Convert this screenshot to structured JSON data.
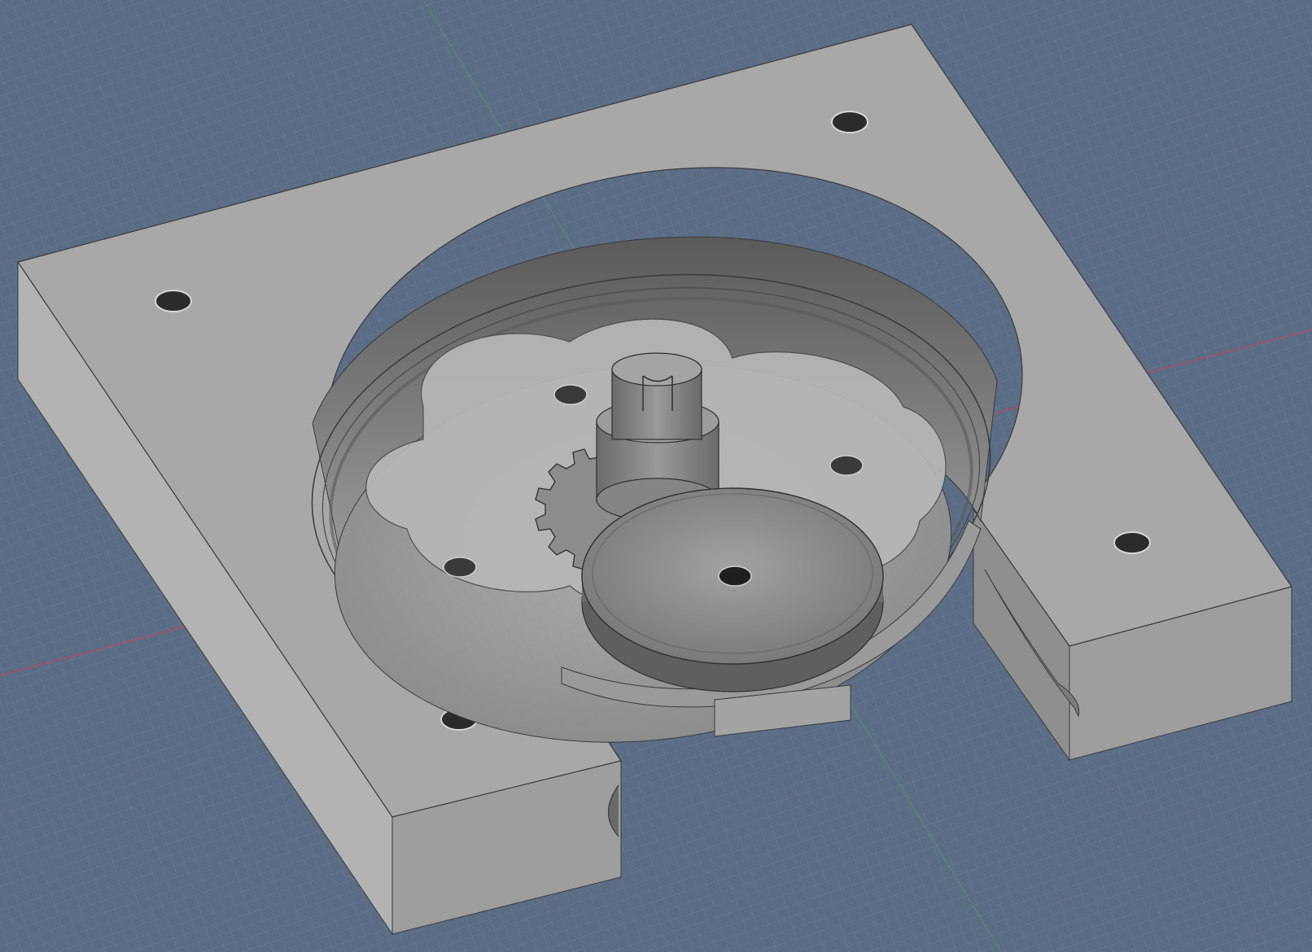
{
  "app": {
    "view": "3d-model-viewport",
    "projection": "isometric"
  },
  "colors": {
    "background": "#5b6c85",
    "grid_minor": "#6f7f96",
    "grid_major": "#8391a6",
    "axis_red": "#c0485a",
    "axis_green": "#4f9a5a",
    "part_top": "#a9a9a9",
    "part_side_left": "#b4b4b4",
    "part_side_front": "#9d9d9d",
    "part_edge": "#3a3a3a",
    "pocket_floor": "#8e8e8e",
    "pocket_wall": "#6e6e6e",
    "gear": "#8a8a8a",
    "spool_top": "#8c8c8c",
    "spool_rim": "#5f5f5f",
    "hole": "#2a2a2a"
  },
  "model": {
    "parts": [
      "base-plate",
      "circular-pocket",
      "rotor-plate",
      "drive-gear",
      "splined-shaft",
      "pulley-wheel",
      "belt-strap",
      "slot-channel"
    ],
    "mounting_holes": 4,
    "rotor_holes": 3
  }
}
